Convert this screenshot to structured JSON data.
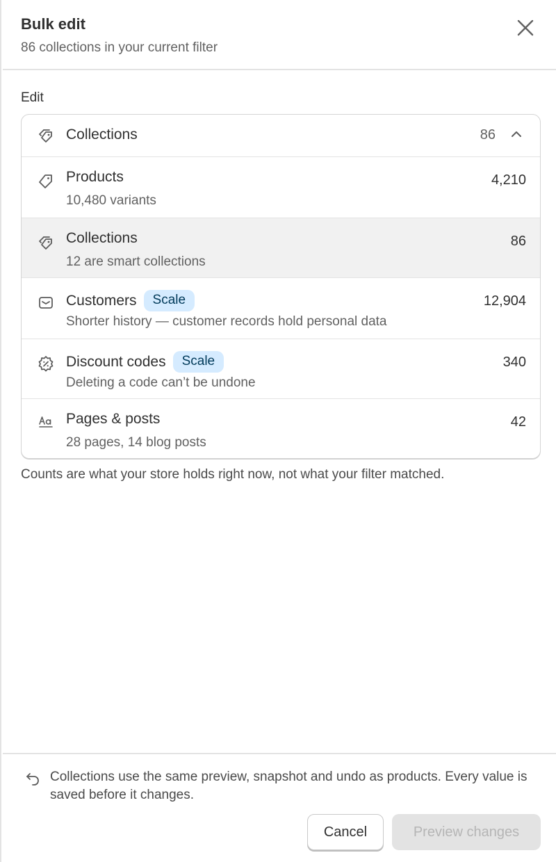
{
  "header": {
    "title": "Bulk edit",
    "subtitle": "86 collections in your current filter"
  },
  "section_label": "Edit",
  "selector": {
    "label": "Collections",
    "count": "86",
    "icon": "collections-tag-icon"
  },
  "items": [
    {
      "label": "Products",
      "description": "10,480 variants",
      "count": "4,210",
      "icon": "product-tag-icon",
      "badge": ""
    },
    {
      "label": "Collections",
      "description": "12 are smart collections",
      "count": "86",
      "icon": "collections-tag-icon",
      "badge": "",
      "selected": true
    },
    {
      "label": "Customers",
      "description": "Shorter history — customer records hold personal data",
      "count": "12,904",
      "icon": "customer-envelope-icon",
      "badge": "Scale"
    },
    {
      "label": "Discount codes",
      "description": "Deleting a code can’t be undone",
      "count": "340",
      "icon": "discount-icon",
      "badge": "Scale"
    },
    {
      "label": "Pages & posts",
      "description": "28 pages, 14 blog posts",
      "count": "42",
      "icon": "text-icon",
      "badge": ""
    }
  ],
  "footnote": "Counts are what your store holds right now, not what your filter matched.",
  "footer": {
    "info": "Collections use the same preview, snapshot and undo as products. Every value is saved before it changes.",
    "cancel_label": "Cancel",
    "preview_label": "Preview changes"
  },
  "colors": {
    "badge_bg": "#d5ebff",
    "badge_text": "#003a5a",
    "selected_row": "#f1f1f1",
    "disabled_button": "#e3e3e3"
  }
}
